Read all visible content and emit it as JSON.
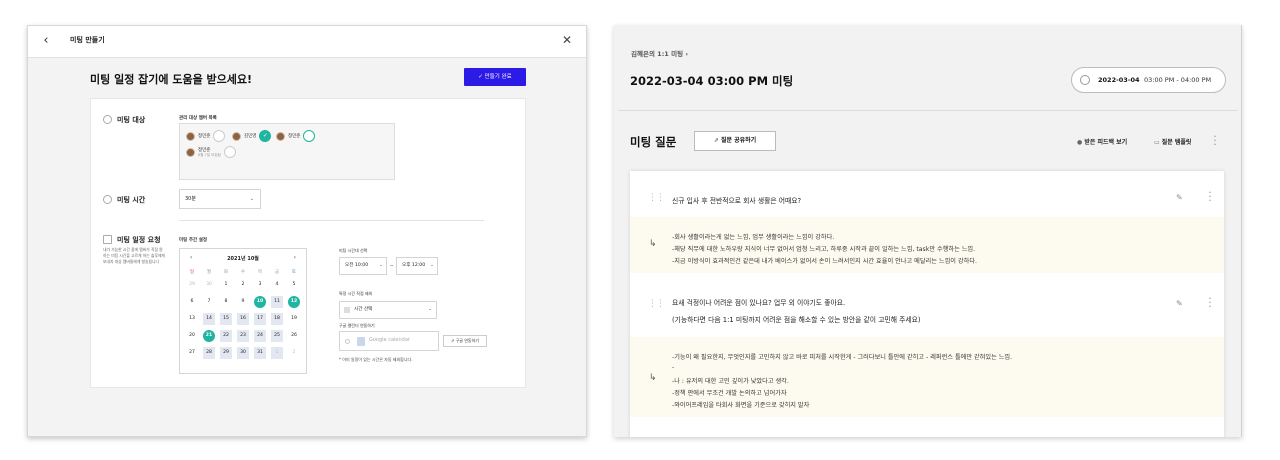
{
  "left": {
    "topbar_title": "미팅 만들기",
    "back_glyph": "‹",
    "close_glyph": "✕",
    "heading": "미팅 일정 잡기에 도움을 받으세요!",
    "done_button": "✓ 만들기 완료",
    "target": {
      "label": "미팅 대상",
      "members_label": "관리 대상 멤버 목록",
      "members": [
        {
          "name": "정민준",
          "state": "off"
        },
        {
          "name": "김민영",
          "state": "on"
        },
        {
          "name": "정민준",
          "state": "ring"
        },
        {
          "name": "정민준",
          "sub": "6월 7일 모집됨",
          "state": "off"
        }
      ]
    },
    "time": {
      "label": "미팅 시간",
      "value": "30분"
    },
    "request": {
      "label": "미팅 일정 요청",
      "description": "내가 가능한 시간 중에 멤버가 직접 원하는 미팅 시간을 고르게 하는 솔루에게 보내지 대상 멤버들에게 발송됩니다",
      "period_label": "미팅 주간 설정",
      "calendar": {
        "title": "2021년 10월",
        "prev": "‹",
        "next": "›",
        "weekdays": [
          "일",
          "월",
          "화",
          "수",
          "목",
          "금",
          "토"
        ],
        "weeks": [
          [
            "29",
            "30",
            "1",
            "2",
            "3",
            "4",
            "5"
          ],
          [
            "6",
            "7",
            "8",
            "9",
            "10",
            "11",
            "12"
          ],
          [
            "13",
            "14",
            "15",
            "16",
            "17",
            "18",
            "19"
          ],
          [
            "20",
            "21",
            "22",
            "23",
            "24",
            "25",
            "26"
          ],
          [
            "27",
            "28",
            "29",
            "30",
            "31",
            "1",
            "2"
          ]
        ]
      },
      "range_label": "미팅 시간대 선택",
      "range_start": "오전 10:00",
      "range_sep": "~",
      "range_end": "오후 12:00",
      "exclude_label": "특정 시간 직접 제외",
      "exclude_value": "시간 선택",
      "gcal_label": "구글 캘린더 연동하기",
      "gcal_placeholder": "Google calendar",
      "gcal_button": "구글 연동하기",
      "note": "* 이미 일정이 있는 시간은 자동 제외합니다."
    }
  },
  "right": {
    "breadcrumb": "김혜은의 1:1 미팅  ›",
    "title": "2022-03-04 03:00 PM 미팅",
    "datetime_date": "2022-03-04",
    "datetime_time": "03:00 PM - 04:00 PM",
    "questions_title": "미팅 질문",
    "share_button": "질문 공유하기",
    "feedback_link": "받은 피드백 보기",
    "template_link": "질문 템플릿",
    "questions": [
      {
        "text": "신규 입사 후 전반적으로 회사 생활은 어때요?",
        "answer": [
          "-회사 생활이라는게 없는 느낌, 업무 생활이라는 느낌이 강하다.",
          "-해당 직무에 대한 노하우랑 지식이 너무 없어서 엄청 느리고, 하루중 시작과 끝이 일하는 느낌, task만 수행하는 느낌.",
          "-지금 이방식이 효과적인건 같은데 내가 베이스가 없어서 손이 느려서인지 시간 효율이 안나고 메달리는 느낌이 강하다."
        ]
      },
      {
        "text": "요새 걱정이나 어려운 점이 있나요? 업무 외 이야기도 좋아요.",
        "text2": "(기능하다면 다음 1:1 미팅까지 어려운 점을 해소할 수 있는 방안을 같이 고민해 주세요)",
        "answer": [
          "-기능이 왜 필요한지, 무엇인지를 고민하지 않고 바로 피처를 시작한게 - 그러다보니 틀안에 갇히고 - 레퍼런스 틀에만 갇혀있는 느낌.",
          "-",
          "-나 : 유저의 대한 고민 깊이가 낮았다고 생각.",
          "-정책 판에서 무조건 개발 논의하고 넘어가자",
          "-와이어프레임을 타회사 화면을 기준으로 갖히지 말자"
        ]
      }
    ]
  }
}
